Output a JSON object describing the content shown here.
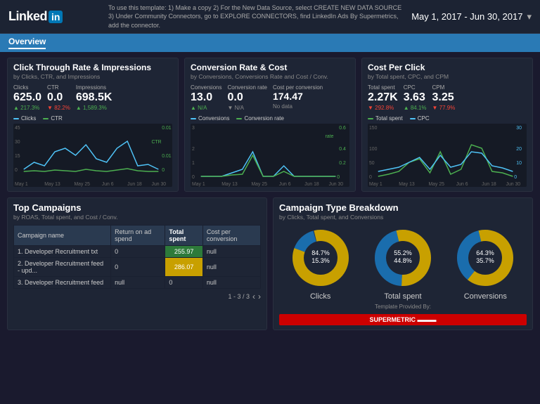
{
  "header": {
    "logo": "Linked",
    "logo_in": "in",
    "instruction": "To use this template: 1) Make a copy 2) For the New Data Source, select CREATE NEW DATA SOURCE 3) Under Community Connectors, go to EXPLORE CONNECTORS, find LinkedIn Ads By Supermetrics, add the connector.",
    "date_range": "May 1, 2017 - Jun 30, 2017",
    "dropdown_arrow": "▾"
  },
  "nav": {
    "active_tab": "Overview"
  },
  "kpi_cards": [
    {
      "title": "Click Through Rate & Impressions",
      "subtitle": "by Clicks, CTR, and Impressions",
      "metrics": [
        {
          "label": "Clicks",
          "value": "625.0",
          "change": "▲ 217.3%",
          "change_type": "pos"
        },
        {
          "label": "CTR",
          "value": "0.0",
          "change": "▼ 82.2%",
          "change_type": "neg"
        },
        {
          "label": "Impressions",
          "value": "698.5K",
          "change": "▲ 1,589.3%",
          "change_type": "pos"
        }
      ],
      "legend": [
        {
          "label": "Clicks",
          "color": "#4fc3f7"
        },
        {
          "label": "CTR",
          "color": "#4caf50"
        }
      ]
    },
    {
      "title": "Conversion Rate & Cost",
      "subtitle": "by Conversions, Conversions Rate and Cost / Conv.",
      "metrics": [
        {
          "label": "Conversions",
          "value": "13.0",
          "change": "▲ N/A",
          "change_type": "na"
        },
        {
          "label": "Conversion rate",
          "value": "0.0",
          "change": "▼ N/A",
          "change_type": "na"
        },
        {
          "label": "Cost per conversion",
          "value": "174.47",
          "change": "No data",
          "change_type": "na"
        }
      ],
      "legend": [
        {
          "label": "Conversions",
          "color": "#4fc3f7"
        },
        {
          "label": "Conversion rate",
          "color": "#4caf50"
        }
      ]
    },
    {
      "title": "Cost Per Click",
      "subtitle": "by Total spent, CPC, and CPM",
      "metrics": [
        {
          "label": "Total spent",
          "value": "2.27K",
          "change": "▼ 292.8%",
          "change_type": "neg"
        },
        {
          "label": "CPC",
          "value": "3.63",
          "change": "▲ 84.1%",
          "change_type": "pos"
        },
        {
          "label": "CPM",
          "value": "3.25",
          "change": "▼ 77.9%",
          "change_type": "neg"
        }
      ],
      "legend": [
        {
          "label": "Total spent",
          "color": "#4caf50"
        },
        {
          "label": "CPC",
          "color": "#4fc3f7"
        }
      ]
    }
  ],
  "campaigns": {
    "title": "Top Campaigns",
    "subtitle": "by ROAS, Total spent, and Cost / Conv.",
    "columns": [
      "Campaign name",
      "Return on ad spend",
      "Total spent",
      "Cost per conversion"
    ],
    "rows": [
      {
        "num": "1.",
        "name": "Developer Recruitment txt",
        "roas": "0",
        "spent": "255.97",
        "cost_conv": "null",
        "spent_highlight": "green"
      },
      {
        "num": "2.",
        "name": "Developer Recruitment feed - upd...",
        "roas": "0",
        "spent": "286.07",
        "cost_conv": "null",
        "spent_highlight": "yellow"
      },
      {
        "num": "3.",
        "name": "Developer Recruitment feed",
        "roas": "null",
        "spent": "0",
        "cost_conv": "null",
        "spent_highlight": "none"
      }
    ],
    "pagination": "1 - 3 / 3"
  },
  "breakdown": {
    "title": "Campaign Type Breakdown",
    "subtitle": "by Clicks, Total spent, and Conversions",
    "charts": [
      {
        "label": "Clicks",
        "pct_yellow": 85,
        "pct_blue": 15
      },
      {
        "label": "Total spent",
        "pct_yellow": 55,
        "pct_blue": 45
      },
      {
        "label": "Conversions",
        "pct_yellow": 65,
        "pct_blue": 35
      }
    ],
    "template_text": "Template Provided By:",
    "supermetric_label": "SUPERMETRIC"
  },
  "colors": {
    "accent_blue": "#2a7ab5",
    "green": "#4caf50",
    "blue_line": "#4fc3f7",
    "yellow": "#c8a000",
    "bg_dark": "#1a1a2e",
    "card_bg": "#1e2535"
  }
}
